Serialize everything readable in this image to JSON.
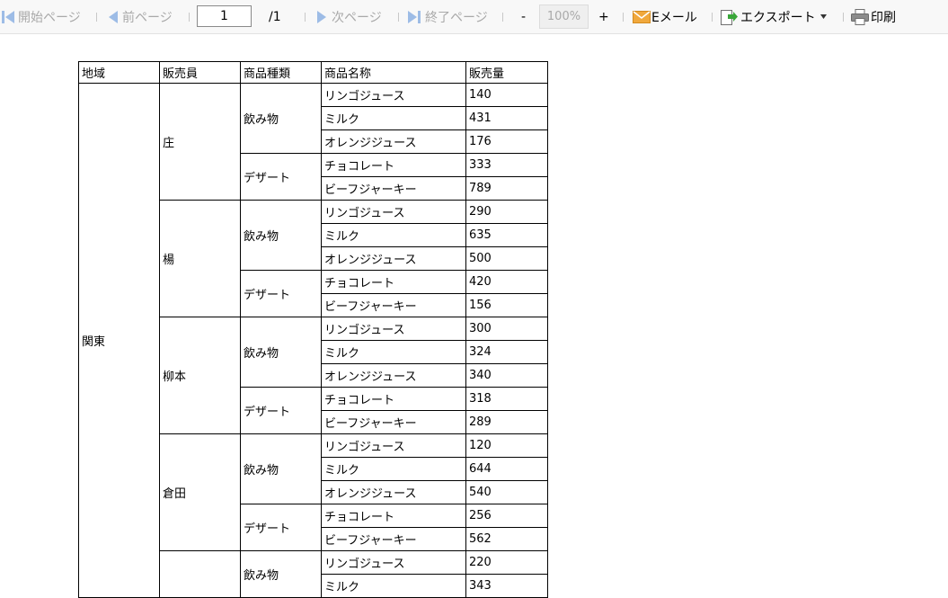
{
  "toolbar": {
    "first_page": "開始ページ",
    "prev_page": "前ページ",
    "page_value": "1",
    "page_total": "/1",
    "next_page": "次ページ",
    "last_page": "終了ページ",
    "zoom_out": "-",
    "zoom_level": "100%",
    "zoom_in": "+",
    "email": "Eメール",
    "export": "エクスポート",
    "print": "印刷"
  },
  "colors": {
    "disabled_text": "#a9a9a9",
    "nav_blue": "#9dbce6",
    "mail_orange": "#f0a83c",
    "export_green": "#3aa63a"
  },
  "report": {
    "headers": [
      "地域",
      "販売員",
      "商品種類",
      "商品名称",
      "販売量"
    ],
    "region": "関東",
    "categories": [
      "飲み物",
      "デザート"
    ],
    "products": [
      "リンゴジュース",
      "ミルク",
      "オレンジジュース",
      "チョコレート",
      "ビーフジャーキー"
    ],
    "sellers": [
      {
        "name": "庄",
        "values": [
          "140",
          "431",
          "176",
          "333",
          "789"
        ]
      },
      {
        "name": "楊",
        "values": [
          "290",
          "635",
          "500",
          "420",
          "156"
        ]
      },
      {
        "name": "柳本",
        "values": [
          "300",
          "324",
          "340",
          "318",
          "289"
        ]
      },
      {
        "name": "倉田",
        "values": [
          "120",
          "644",
          "540",
          "256",
          "562"
        ]
      },
      {
        "name": "",
        "values": [
          "220",
          "343"
        ]
      }
    ]
  }
}
